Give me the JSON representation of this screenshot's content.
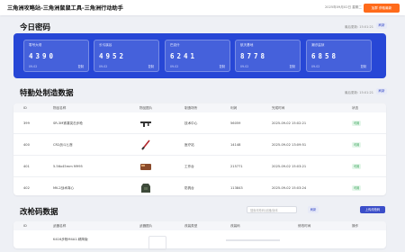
{
  "header": {
    "title": "三角洲攻略站-三角洲鼠鼠工具-三角洲行动助手",
    "note": "2025年09月02日 星期二",
    "cta": "加群 获取最新"
  },
  "codes": {
    "title": "今日密码",
    "updated": "最后更新: 15:01:21",
    "refresh": "刷新",
    "cards": [
      {
        "name": "零号大坝",
        "code": "4390",
        "date": "09-02",
        "copy": "复制"
      },
      {
        "name": "长弓溪谷",
        "code": "4952",
        "date": "09-02",
        "copy": "复制"
      },
      {
        "name": "巴克什",
        "code": "6241",
        "date": "09-02",
        "copy": "复制"
      },
      {
        "name": "航天基地",
        "code": "8778",
        "date": "09-02",
        "copy": "复制"
      },
      {
        "name": "潮汐监狱",
        "code": "6858",
        "date": "09-02",
        "copy": "复制"
      }
    ]
  },
  "special": {
    "title": "特勤处制造数据",
    "updated": "最后更新: 15:01:21",
    "refresh": "刷新",
    "headers": [
      "ID",
      "物品名称",
      "物品图片",
      "制造场所",
      "利润",
      "完成时间",
      "状态"
    ],
    "rows": [
      {
        "id": "399",
        "name": "SR-3M紧凑突击步枪",
        "place": "技术中心",
        "profit": "56059",
        "time": "2025-09-02 15:02:21",
        "status": "可用"
      },
      {
        "id": "400",
        "name": "CR2战斗匕首",
        "place": "医疗站",
        "profit": "14148",
        "time": "2025-09-02 13:09:51",
        "status": "可用"
      },
      {
        "id": "401",
        "name": "5.56x45mm M995",
        "place": "工作台",
        "profit": "215771",
        "time": "2025-09-02 15:03:21",
        "status": "可用"
      },
      {
        "id": "402",
        "name": "MK-2战术背心",
        "place": "防具台",
        "profit": "113843",
        "time": "2025-09-02 15:03:24",
        "status": "可用"
      }
    ]
  },
  "mods": {
    "title": "改枪码数据",
    "search_placeholder": "搜索改枪码/武器/版本",
    "refresh": "刷新",
    "upload": "上传改枪码",
    "headers": [
      "ID",
      "武器名称",
      "武器图片",
      "改装类型",
      "改装码",
      "修改时间",
      "操作"
    ],
    "first_row_name": "K416步枪M4A1-精简版"
  }
}
